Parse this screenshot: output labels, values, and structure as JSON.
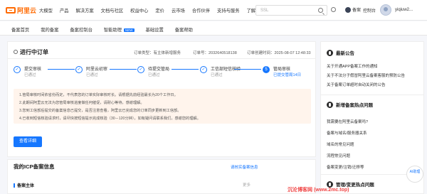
{
  "header": {
    "logo_text": "阿里云",
    "nav": [
      "大模型",
      "产品",
      "解决方案",
      "文档与社区",
      "权益中心",
      "定价",
      "云市场",
      "合作伙伴",
      "支持与服务",
      "了解阿里云"
    ],
    "search_placeholder": "SSL",
    "beian_label": "备案",
    "console_label": "控制台",
    "user_name": "yiqiuw2..."
  },
  "subnav": {
    "items": [
      "备案首页",
      "我的备案",
      "备案控制台",
      "智能助理",
      "基础设置",
      "备案帮助"
    ],
    "new_badge": "NEW"
  },
  "order": {
    "title": "进行中订单",
    "type_label": "订单类型：有主体新增服务",
    "id_label": "订单号：2032640518138",
    "created_label": "订单创建时间：2025-08-07 12:48:33",
    "steps": [
      {
        "num": "✓",
        "label": "提交审核",
        "status": "已通过"
      },
      {
        "num": "✓",
        "label": "阿里云初审",
        "status": "已通过"
      },
      {
        "num": "✓",
        "label": "待提交管局",
        "status": "已通过"
      },
      {
        "num": "✓",
        "label": "工信部短信核验",
        "status": "已通过"
      },
      {
        "num": "5",
        "label": "管局审核",
        "status": "已提交管局14日"
      }
    ],
    "notices": [
      "1.管局审核时间依省份而定，不代表您的订单实际审核时长。请根据先前经验最长为20个工作日。",
      "2.此期间阿里云无法为您管局审核进度做任何催促，请耐心等待，感谢理解。",
      "3.您到工信部后提交的备案信息已提交，是否注意查看，阿里云已完成您的订单同步更新到工信部。",
      "4.已收到短信核验请求时，请尽快按短信提示完成核验（30－120分钟），如有疑问请联系我们，感谢您的理解。"
    ],
    "action_label": "查看详细"
  },
  "icp": {
    "title": "我的ICP备案信息",
    "link": "请核实备案信息",
    "subject_label": "备案主体",
    "muted": "更多"
  },
  "sidebar": {
    "announcements_title": "最新公告",
    "announcements": [
      "关于开通APP备案工作的通知",
      "关于不法分子假冒阿里云备案客服的预防公告",
      "关于备案订单超时自动关闭的公告"
    ],
    "faq_title": "新增备案热点问题",
    "faq": [
      "我需要在阿里云备案吗?",
      "备案与域名/服务器关系",
      "域名的常见问题",
      "流程常见问题",
      "备案变更/注销/迁移等"
    ],
    "change_title": "管理/变更热点问题"
  },
  "ai_button": "AI助理",
  "watermark": "沉沦博客网 (www.2mc.top)"
}
